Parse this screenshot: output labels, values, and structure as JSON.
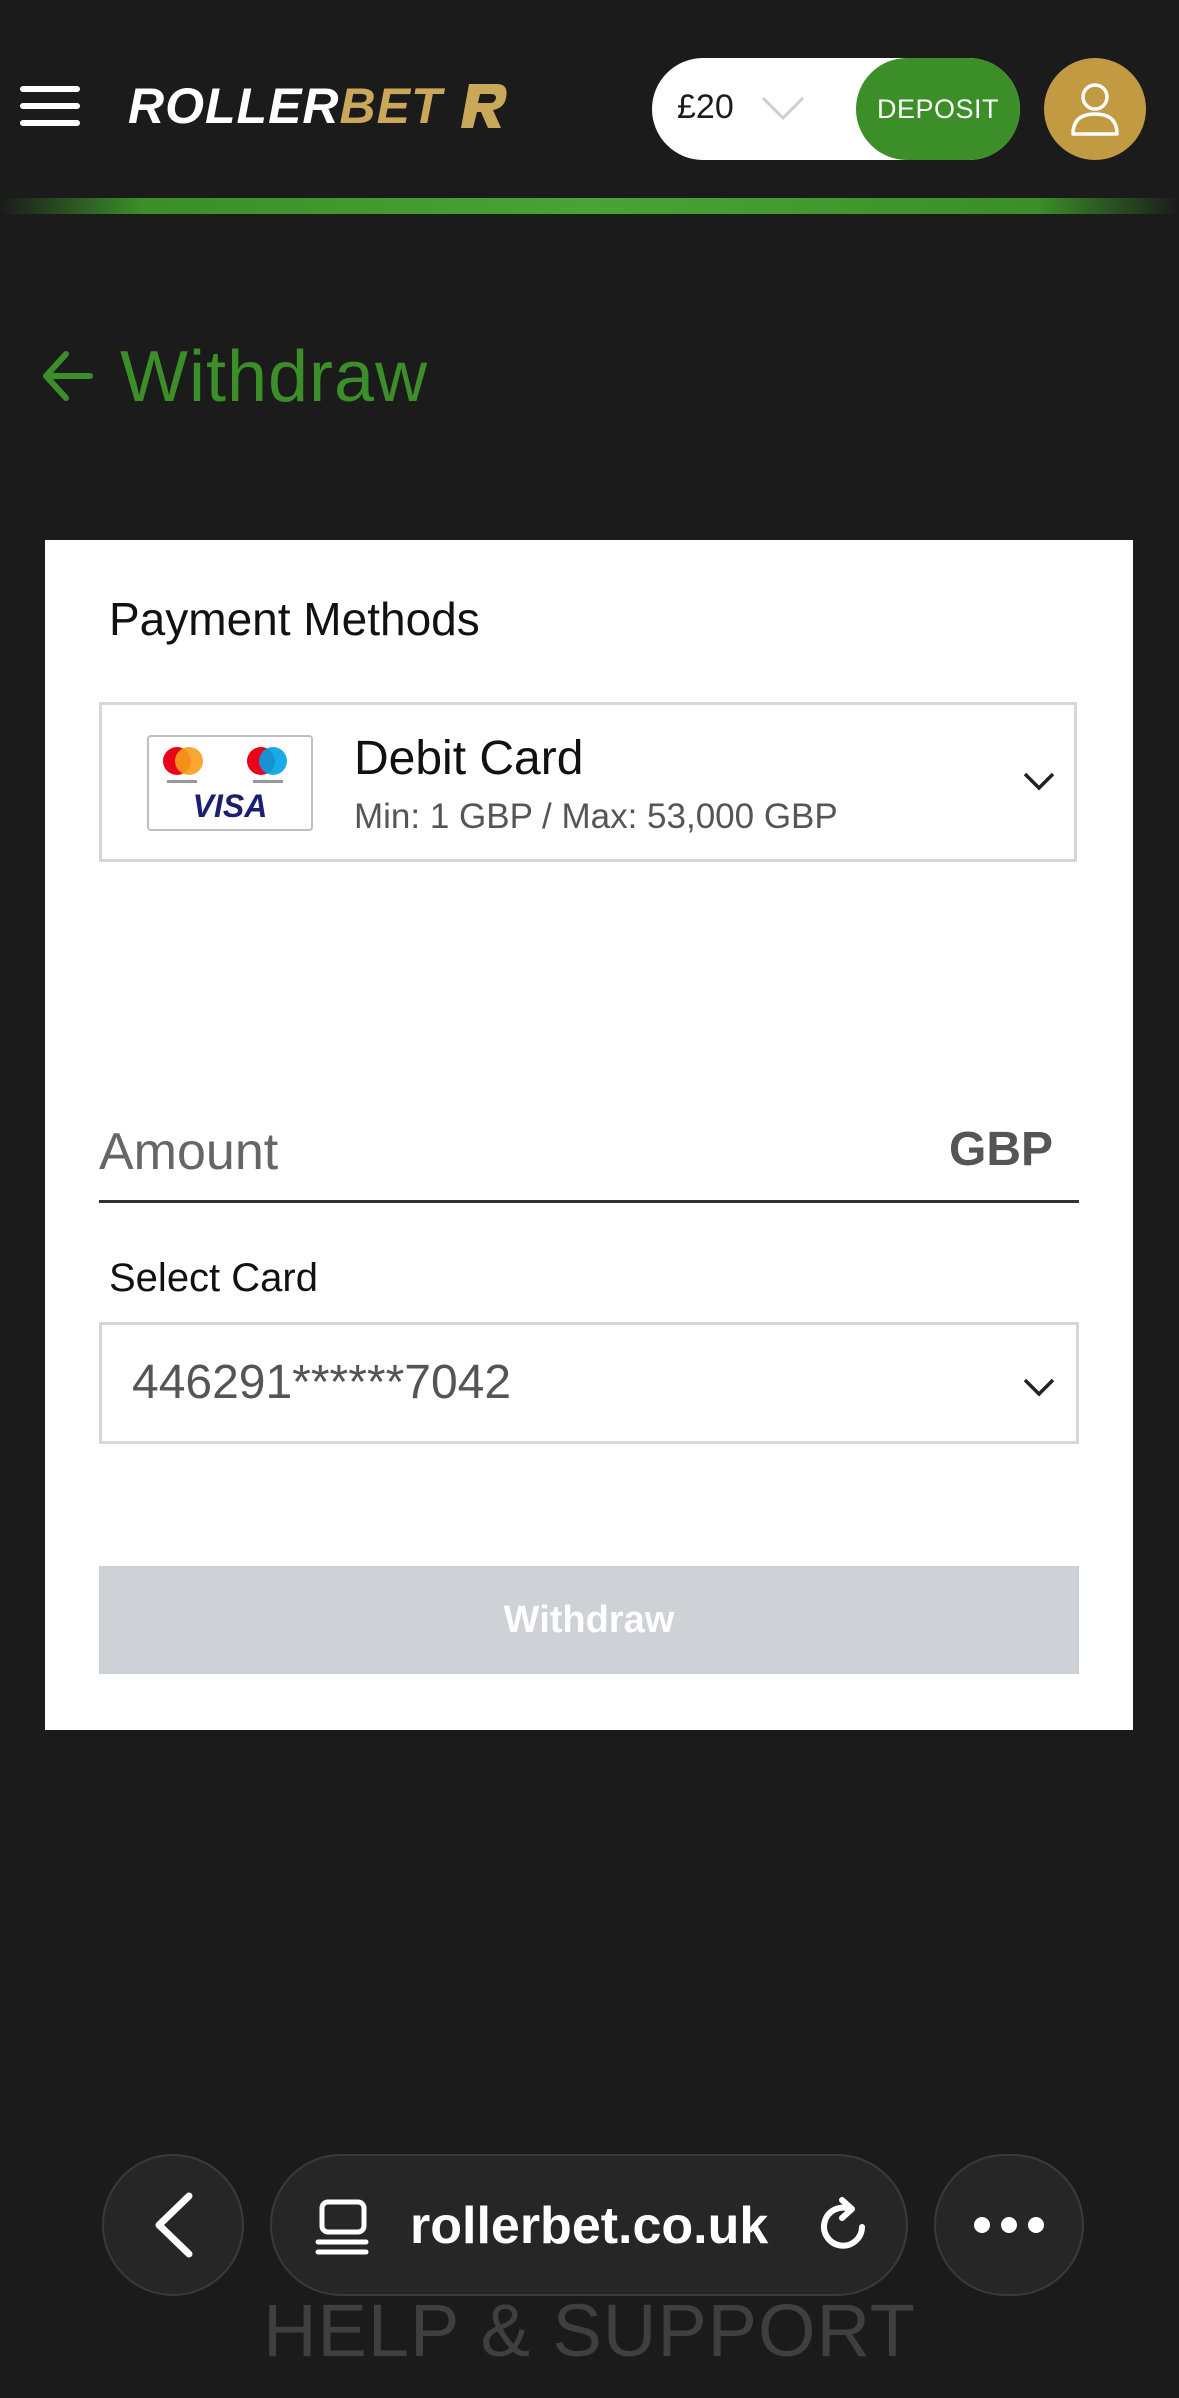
{
  "header": {
    "logo_part1": "ROLLER",
    "logo_part2": "BET",
    "balance": "£20",
    "deposit_label": "DEPOSIT"
  },
  "page": {
    "title": "Withdraw"
  },
  "payment": {
    "section_label": "Payment Methods",
    "method_name": "Debit Card",
    "method_limits": "Min: 1 GBP / Max: 53,000 GBP",
    "card_logo_text": "VISA"
  },
  "amount": {
    "placeholder": "Amount",
    "currency": "GBP"
  },
  "select_card": {
    "label": "Select Card",
    "value": "446291******7042"
  },
  "actions": {
    "withdraw_label": "Withdraw"
  },
  "browser": {
    "url": "rollerbet.co.uk",
    "footer_text": "HELP & SUPPORT"
  },
  "colors": {
    "brand_green": "#3b8e28",
    "brand_gold": "#c19a41",
    "background": "#1b1b1b"
  }
}
